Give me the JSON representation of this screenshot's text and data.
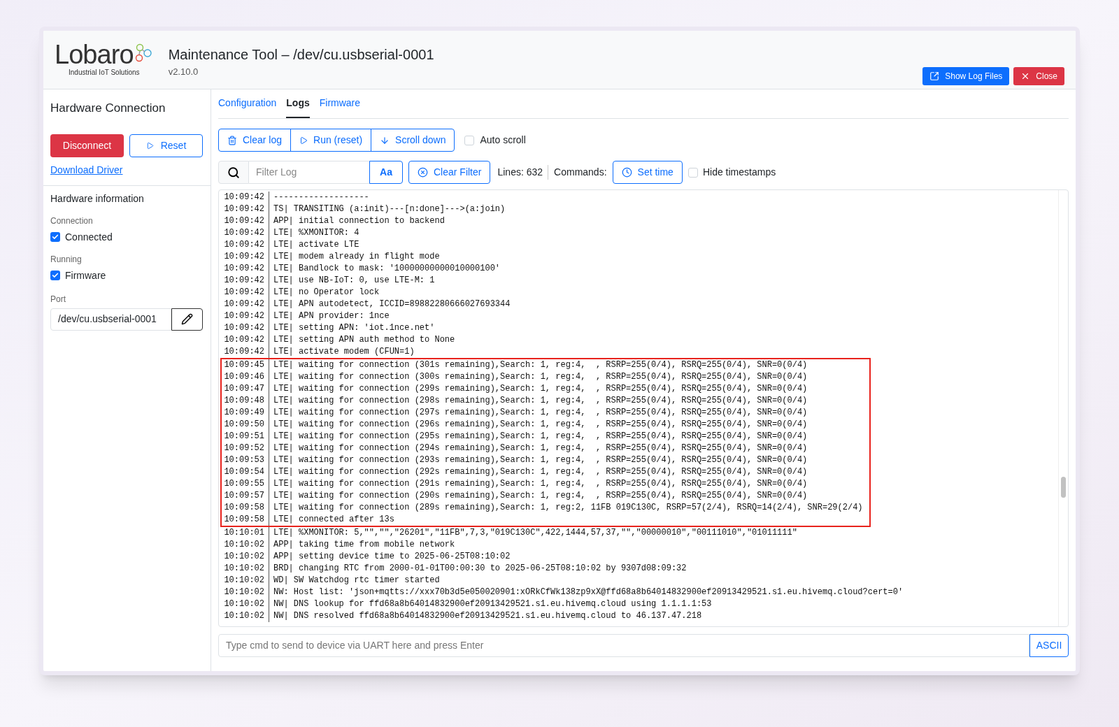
{
  "header": {
    "logo": {
      "name": "Lobaro",
      "tagline": "Industrial IoT Solutions"
    },
    "title": "Maintenance Tool – /dev/cu.usbserial-0001",
    "version": "v2.10.0",
    "buttons": [
      {
        "label": "Show Log Files",
        "kind": "primary"
      },
      {
        "label": "Close",
        "kind": "danger"
      }
    ]
  },
  "sidebar": {
    "title": "Hardware Connection",
    "buttons": [
      {
        "label": "Disconnect",
        "kind": "danger"
      },
      {
        "label": "Reset",
        "kind": "outline"
      }
    ],
    "link": "Download Driver",
    "info_title": "Hardware information",
    "fields": [
      {
        "label": "Connection",
        "checkbox": {
          "label": "Connected",
          "checked": true
        }
      },
      {
        "label": "Running",
        "checkbox": {
          "label": "Firmware",
          "checked": true
        }
      }
    ],
    "port": {
      "label": "Port",
      "value": "/dev/cu.usbserial-0001"
    }
  },
  "tabs": [
    {
      "label": "Configuration",
      "selected": false
    },
    {
      "label": "Logs",
      "selected": true
    },
    {
      "label": "Firmware",
      "selected": false
    }
  ],
  "toolbar": {
    "buttons": [
      {
        "label": "Clear log",
        "kind": "trash"
      },
      {
        "label": "Run (reset)",
        "kind": "play"
      },
      {
        "label": "Scroll down",
        "kind": "down"
      }
    ],
    "auto_scroll": {
      "label": "Auto scroll",
      "checked": false
    }
  },
  "filter": {
    "placeholder": "Filter Log",
    "case_button": "Aa",
    "clear_button": "Clear Filter",
    "lines": "Lines: 632",
    "commands_label": "Commands:",
    "set_time": "Set time",
    "hide_timestamps": {
      "label": "Hide timestamps",
      "checked": false
    }
  },
  "log": {
    "blocks": [
      {
        "highlighted": false,
        "rows": [
          {
            "time": "10:09:42",
            "text": "-------------------"
          },
          {
            "time": "10:09:42",
            "text": "TS| TRANSITING (a:init)---[n:done]--->(a:join)"
          },
          {
            "time": "10:09:42",
            "text": "APP| initial connection to backend"
          },
          {
            "time": "10:09:42",
            "text": "LTE| %XMONITOR: 4"
          },
          {
            "time": "10:09:42",
            "text": "LTE| activate LTE"
          },
          {
            "time": "10:09:42",
            "text": "LTE| modem already in flight mode"
          },
          {
            "time": "10:09:42",
            "text": "LTE| Bandlock to mask: '10000000000010000100'"
          },
          {
            "time": "10:09:42",
            "text": "LTE| use NB-IoT: 0, use LTE-M: 1"
          },
          {
            "time": "10:09:42",
            "text": "LTE| no Operator lock"
          },
          {
            "time": "10:09:42",
            "text": "LTE| APN autodetect, ICCID=89882280666027693344"
          },
          {
            "time": "10:09:42",
            "text": "LTE| APN provider: 1nce"
          },
          {
            "time": "10:09:42",
            "text": "LTE| setting APN: 'iot.1nce.net'"
          },
          {
            "time": "10:09:42",
            "text": "LTE| setting APN auth method to None"
          },
          {
            "time": "10:09:42",
            "text": "LTE| activate modem (CFUN=1)"
          }
        ]
      },
      {
        "highlighted": true,
        "rows": [
          {
            "time": "10:09:45",
            "text": "LTE| waiting for connection (301s remaining),Search: 1, reg:4,  , RSRP=255(0/4), RSRQ=255(0/4), SNR=0(0/4)"
          },
          {
            "time": "10:09:46",
            "text": "LTE| waiting for connection (300s remaining),Search: 1, reg:4,  , RSRP=255(0/4), RSRQ=255(0/4), SNR=0(0/4)"
          },
          {
            "time": "10:09:47",
            "text": "LTE| waiting for connection (299s remaining),Search: 1, reg:4,  , RSRP=255(0/4), RSRQ=255(0/4), SNR=0(0/4)"
          },
          {
            "time": "10:09:48",
            "text": "LTE| waiting for connection (298s remaining),Search: 1, reg:4,  , RSRP=255(0/4), RSRQ=255(0/4), SNR=0(0/4)"
          },
          {
            "time": "10:09:49",
            "text": "LTE| waiting for connection (297s remaining),Search: 1, reg:4,  , RSRP=255(0/4), RSRQ=255(0/4), SNR=0(0/4)"
          },
          {
            "time": "10:09:50",
            "text": "LTE| waiting for connection (296s remaining),Search: 1, reg:4,  , RSRP=255(0/4), RSRQ=255(0/4), SNR=0(0/4)"
          },
          {
            "time": "10:09:51",
            "text": "LTE| waiting for connection (295s remaining),Search: 1, reg:4,  , RSRP=255(0/4), RSRQ=255(0/4), SNR=0(0/4)"
          },
          {
            "time": "10:09:52",
            "text": "LTE| waiting for connection (294s remaining),Search: 1, reg:4,  , RSRP=255(0/4), RSRQ=255(0/4), SNR=0(0/4)"
          },
          {
            "time": "10:09:53",
            "text": "LTE| waiting for connection (293s remaining),Search: 1, reg:4,  , RSRP=255(0/4), RSRQ=255(0/4), SNR=0(0/4)"
          },
          {
            "time": "10:09:54",
            "text": "LTE| waiting for connection (292s remaining),Search: 1, reg:4,  , RSRP=255(0/4), RSRQ=255(0/4), SNR=0(0/4)"
          },
          {
            "time": "10:09:55",
            "text": "LTE| waiting for connection (291s remaining),Search: 1, reg:4,  , RSRP=255(0/4), RSRQ=255(0/4), SNR=0(0/4)"
          },
          {
            "time": "10:09:57",
            "text": "LTE| waiting for connection (290s remaining),Search: 1, reg:4,  , RSRP=255(0/4), RSRQ=255(0/4), SNR=0(0/4)"
          },
          {
            "time": "10:09:58",
            "text": "LTE| waiting for connection (289s remaining),Search: 1, reg:2, 11FB 019C130C, RSRP=57(2/4), RSRQ=14(2/4), SNR=29(2/4)"
          },
          {
            "time": "10:09:58",
            "text": "LTE| connected after 13s"
          }
        ]
      },
      {
        "highlighted": false,
        "rows": [
          {
            "time": "10:10:01",
            "text": "LTE| %XMONITOR: 5,\"\",\"\",\"26201\",\"11FB\",7,3,\"019C130C\",422,1444,57,37,\"\",\"00000010\",\"00111010\",\"01011111\""
          },
          {
            "time": "10:10:02",
            "text": "APP| taking time from mobile network"
          },
          {
            "time": "10:10:02",
            "text": "APP| setting device time to 2025-06-25T08:10:02"
          },
          {
            "time": "10:10:02",
            "text": "BRD| changing RTC from 2000-01-01T00:00:30 to 2025-06-25T08:10:02 by 9307d08:09:32"
          },
          {
            "time": "10:10:02",
            "text": "WD| SW Watchdog rtc timer started"
          },
          {
            "time": "10:10:02",
            "text": "NW: Host list: 'json+mqtts://xxx70b3d5e050020901:xORkCfWk138zp9xX@ffd68a8b64014832900ef20913429521.s1.eu.hivemq.cloud?cert=0'"
          },
          {
            "time": "10:10:02",
            "text": "NW| DNS lookup for ffd68a8b64014832900ef20913429521.s1.eu.hivemq.cloud using 1.1.1.1:53"
          },
          {
            "time": "10:10:02",
            "text": "NW| DNS resolved ffd68a8b64014832900ef20913429521.s1.eu.hivemq.cloud to 46.137.47.218"
          }
        ]
      }
    ]
  },
  "command": {
    "placeholder": "Type cmd to send to device via UART here and press Enter",
    "mode": "ASCII"
  }
}
